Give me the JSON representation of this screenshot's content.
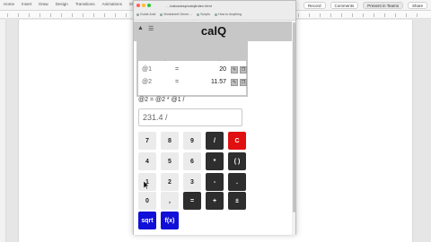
{
  "host": {
    "menu": [
      "Home",
      "Insert",
      "Draw",
      "Design",
      "Transitions",
      "Animations",
      "Sl"
    ],
    "chips": [
      "Record",
      "Comments",
      "Present in Teams",
      "Share"
    ]
  },
  "browser": {
    "url": "…/calcadosp/calqlindex.html",
    "bookmarks": [
      "Guide Anki",
      "Worksheet Gener…",
      "Scripts",
      "How to Anything"
    ]
  },
  "app": {
    "title": "calQ",
    "rows": [
      {
        "var": "@1",
        "eq": "=",
        "value": "20"
      },
      {
        "var": "@2",
        "eq": "=",
        "value": "11.57"
      }
    ],
    "expression": "@2 =  @2 * @1 /",
    "input_value": "231.4 /",
    "keys": {
      "k7": "7",
      "k8": "8",
      "k9": "9",
      "div": "/",
      "clear": "C",
      "k4": "4",
      "k5": "5",
      "k6": "6",
      "mul": "*",
      "paren": "( )",
      "k1": "1",
      "k2": "2",
      "k3": "3",
      "sub": "-",
      "dot": ".",
      "k0": "0",
      "comma": ",",
      "eq": "=",
      "add": "+",
      "pm": "±",
      "sqrt": "sqrt",
      "fx": "f(x)"
    }
  },
  "colors": {
    "clear": "#e01010",
    "func": "#1010d8",
    "op": "#2e2e2e",
    "header": "#c7c7c7"
  }
}
